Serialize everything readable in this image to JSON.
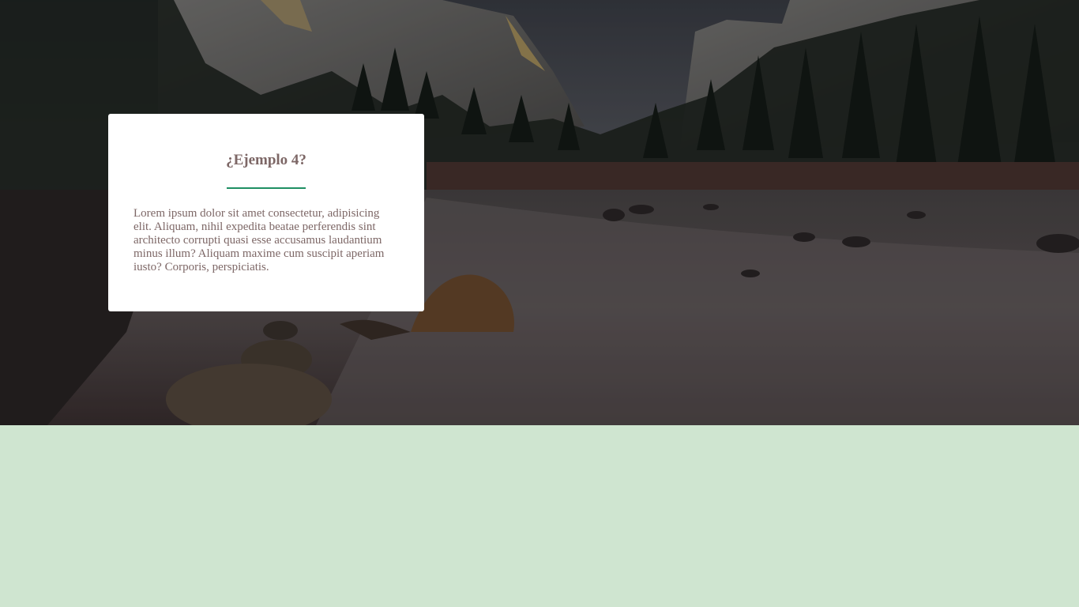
{
  "card": {
    "title": "¿Ejemplo 4?",
    "text": "Lorem ipsum dolor sit amet consectetur, adipisicing elit. Aliquam, nihil expedita beatae perferendis sint architecto corrupti quasi esse accusamus laudantium minus illum? Aliquam maxime cum suscipit aperiam iusto? Corporis, perspiciatis."
  },
  "colors": {
    "accent": "#1f8f63",
    "text": "#7d6766",
    "page_background": "#cfe5d0",
    "card_background": "#ffffff"
  },
  "hero_image": {
    "subject": "mountain-river-landscape"
  }
}
